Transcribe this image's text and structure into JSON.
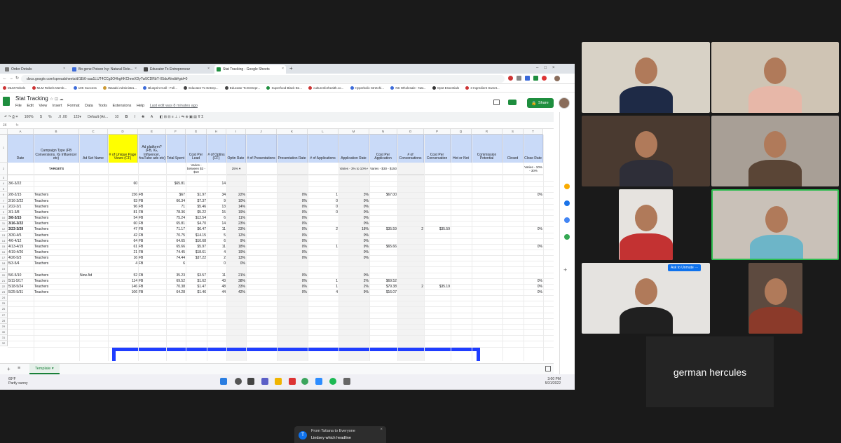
{
  "browser": {
    "tabs": [
      {
        "label": "Order Details",
        "color": "#777777"
      },
      {
        "label": "Bo gene Poison Ivy: Natural Rele...",
        "color": "#3b6ad9"
      },
      {
        "label": "Educator To Entrepreneur",
        "color": "#444444"
      },
      {
        "label": "Stat Tracking - Google Sheets",
        "color": "#1e8e3e"
      }
    ],
    "new_tab": "+",
    "url": "docs.google.com/spreadsheets/d/1Ei6-xaa1LUT4CCg3O4hgHKChnnXDyTw5CDRbT-X5dcA/edit#gid=0",
    "bookmarks": [
      "MLM Rebels",
      "MLM Rebels Memb...",
      "10K Success",
      "Wasabi Administra...",
      "Blueprint Call - Foll...",
      "Educator To Entrep...",
      "Educator To Entrepr...",
      "Superfood Black Be...",
      "culturesforhealth.co...",
      "Hyperbolic Stretchi...",
      "NS Wholesale - Nat...",
      "Opst Essentials",
      "3 Ingredient Sweet..."
    ]
  },
  "sheets": {
    "title": "Stat Tracking",
    "menus": [
      "File",
      "Edit",
      "View",
      "Insert",
      "Format",
      "Data",
      "Tools",
      "Extensions",
      "Help"
    ],
    "last_edit": "Last edit was 8 minutes ago",
    "share": "Share",
    "toolbar": {
      "zoom": "100%",
      "currency": "$",
      "percent": "%",
      "decimals": ".0  .00",
      "format": "123▾",
      "font": "Default (Ari...",
      "size": "10",
      "bold": "B",
      "italic": "I",
      "strike": "S",
      "color": "A"
    },
    "namebox": "J4",
    "columns": [
      "A",
      "B",
      "C",
      "D",
      "E",
      "F",
      "G",
      "H",
      "I",
      "J",
      "K",
      "L",
      "M",
      "N",
      "O",
      "P",
      "Q",
      "R",
      "S",
      "T"
    ],
    "headers": [
      "Date",
      "Campaign Type (FB Conversions, IG Influencer etc)",
      "Ad Set Name",
      "# of Unique Page Views (CF)",
      "Ad platform? (FB, IG, Influencer, YouTube ads etc)",
      "Total Spent",
      "Cost Per Lead",
      "# of Optins (CF)",
      "Optin Rate",
      "# of Presentations",
      "Presentation Rate",
      "# of Applications",
      "Application Rate",
      "Cost Per Application",
      "# of Conversations",
      "Cost Per Conversation",
      "Hot or Not",
      "Commission Potential",
      "Closed",
      "Close Rate"
    ],
    "targets": {
      "label": "TARGETS",
      "cost_per_lead": "Varies - between $3 - $10",
      "optin_rate": "25% ▾",
      "application_rate": "Varies - 3% to 10%+",
      "cost_per_application": "Varies - $30 - $150",
      "close_rate": "Varies - 10% - 30%"
    },
    "row_numbers": [
      "1",
      "2",
      "3",
      "4",
      "5",
      "6",
      "7",
      "8",
      "9",
      "10",
      "11",
      "12",
      "13",
      "14",
      "15",
      "16",
      "17",
      "18",
      "19",
      "20",
      "21",
      "22",
      "23",
      "24",
      "25",
      "26",
      "27",
      "28",
      "29",
      "30",
      "31",
      "32"
    ],
    "rows": [
      {
        "row": 3,
        "date": "3/6-3/22",
        "views": "60",
        "spent": "$65.81",
        "optins": "14"
      },
      {
        "row": 5,
        "date": "2/8-2/15",
        "campaign": "Teachers",
        "views": "156",
        "platform": "FB",
        "spent": "$67",
        "cpl": "$1.97",
        "optins": "34",
        "optin_rate": "22%",
        "pres_rate": "0%",
        "apps": "1",
        "app_rate": "3%",
        "cpa": "$67.00",
        "close_rate": "0%"
      },
      {
        "row": 6,
        "date": "2/16-2/22",
        "campaign": "Teachers",
        "views": "93",
        "platform": "FB",
        "spent": "66.34",
        "cpl": "$7.37",
        "optins": "9",
        "optin_rate": "10%",
        "pres_rate": "0%",
        "apps": "0",
        "app_rate": "0%"
      },
      {
        "row": 7,
        "date": "2/22-3/1",
        "campaign": "Teachers",
        "views": "96",
        "platform": "FB",
        "spent": "71",
        "cpl": "$5.46",
        "optins": "13",
        "optin_rate": "14%",
        "pres_rate": "0%",
        "apps": "0",
        "app_rate": "0%"
      },
      {
        "row": 8,
        "date": "3/1-3/8",
        "campaign": "Teachers",
        "views": "81",
        "platform": "FB",
        "spent": "78.36",
        "cpl": "$5.22",
        "optins": "15",
        "optin_rate": "19%",
        "pres_rate": "0%",
        "apps": "0",
        "app_rate": "0%"
      },
      {
        "row": 9,
        "date": "3/8-3/15",
        "campaign": "Teachers",
        "views": "54",
        "platform": "FB",
        "spent": "75.24",
        "cpl": "$12.54",
        "optins": "6",
        "optin_rate": "11%",
        "pres_rate": "0%",
        "app_rate": "0%"
      },
      {
        "row": 10,
        "date": "3/16-3/22",
        "campaign": "Teachers",
        "views": "60",
        "platform": "FB",
        "spent": "65.81",
        "cpl": "$4.70",
        "optins": "14",
        "optin_rate": "23%",
        "pres_rate": "0%",
        "app_rate": "0%"
      },
      {
        "row": 11,
        "date": "3/23-3/29",
        "campaign": "Teachers",
        "views": "47",
        "platform": "FB",
        "spent": "71.17",
        "cpl": "$6.47",
        "optins": "11",
        "optin_rate": "23%",
        "pres_rate": "0%",
        "apps": "2",
        "app_rate": "18%",
        "cpa": "$35.59",
        "convos": "2",
        "cpc": "$35.59",
        "close_rate": "0%"
      },
      {
        "row": 12,
        "date": "3/30-4/5",
        "campaign": "Teachers",
        "views": "42",
        "platform": "FB",
        "spent": "70.75",
        "cpl": "$14.15",
        "optins": "5",
        "optin_rate": "12%",
        "pres_rate": "0%",
        "app_rate": "0%"
      },
      {
        "row": 13,
        "date": "4/6-4/12",
        "campaign": "Teachers",
        "views": "64",
        "platform": "FB",
        "spent": "64.65",
        "cpl": "$10.68",
        "optins": "6",
        "optin_rate": "9%",
        "pres_rate": "0%",
        "app_rate": "0%"
      },
      {
        "row": 14,
        "date": "4/13-4/19",
        "campaign": "Teachers",
        "views": "61",
        "platform": "FB",
        "spent": "65.66",
        "cpl": "$5.97",
        "optins": "11",
        "optin_rate": "18%",
        "pres_rate": "0%",
        "apps": "1",
        "app_rate": "9%",
        "cpa": "$65.66",
        "close_rate": "0%"
      },
      {
        "row": 15,
        "date": "4/19-4/26",
        "campaign": "Teachers",
        "views": "21",
        "platform": "FB",
        "spent": "74.45",
        "cpl": "$18.61",
        "optins": "4",
        "optin_rate": "19%",
        "pres_rate": "0%",
        "app_rate": "0%"
      },
      {
        "row": 16,
        "date": "4/26-5/3",
        "campaign": "Teachers",
        "views": "16",
        "platform": "FB",
        "spent": "74.44",
        "cpl": "$37.22",
        "optins": "2",
        "optin_rate": "13%",
        "pres_rate": "0%",
        "app_rate": "0%"
      },
      {
        "row": 17,
        "date": "5/3-5/4",
        "campaign": "Teachers",
        "views": "4",
        "platform": "FB",
        "spent": "6",
        "optins": "0",
        "optin_rate": "0%"
      },
      {
        "row": 19,
        "date": "5/6-5/10",
        "campaign": "Teachers",
        "adset": "New Ad",
        "views": "52",
        "platform": "FB",
        "spent": "35.23",
        "cpl": "$3.57",
        "optins": "11",
        "optin_rate": "21%",
        "pres_rate": "0%",
        "app_rate": "0%"
      },
      {
        "row": 20,
        "date": "5/11-5/17",
        "campaign": "Teachers",
        "views": "114",
        "platform": "FB",
        "spent": "69.52",
        "cpl": "$1.62",
        "optins": "43",
        "optin_rate": "38%",
        "pres_rate": "0%",
        "apps": "1",
        "app_rate": "2%",
        "cpa": "$69.52",
        "close_rate": "0%"
      },
      {
        "row": 21,
        "date": "5/18-5/24",
        "campaign": "Teachers",
        "views": "146",
        "platform": "FB",
        "spent": "70.38",
        "cpl": "$1.47",
        "optins": "48",
        "optin_rate": "33%",
        "pres_rate": "0%",
        "apps": "1",
        "app_rate": "2%",
        "cpa": "$79.38",
        "convos": "2",
        "cpc": "$35.19",
        "close_rate": "0%"
      },
      {
        "row": 22,
        "date": "5/25-5/31",
        "campaign": "Teachers",
        "views": "106",
        "platform": "FB",
        "spent": "64.28",
        "cpl": "$1.46",
        "optins": "44",
        "optin_rate": "42%",
        "pres_rate": "0%",
        "apps": "4",
        "app_rate": "9%",
        "cpa": "$16.07",
        "close_rate": "0%"
      }
    ],
    "sheet_tab": "Template",
    "add_sheet": "+",
    "all_sheets": "≡"
  },
  "taskbar": {
    "temp": "69°F",
    "weather": "Partly sunny",
    "time": "3:00 PM",
    "date": "5/31/2022"
  },
  "zoom": {
    "participants": [
      {
        "role": "participant",
        "color_bg": "#d8d2c6",
        "color_person": "#1e2a46"
      },
      {
        "role": "participant",
        "color_bg": "#cfc4b4",
        "color_person": "#e7b7a8"
      },
      {
        "role": "participant",
        "color_bg": "#4a3a30",
        "color_person": "#2e2e38"
      },
      {
        "role": "participant",
        "color_bg": "#a89f96",
        "color_person": "#5a4536"
      },
      {
        "role": "participant",
        "color_bg": "#e6e3df",
        "color_person": "#c33232"
      },
      {
        "role": "active-speaker",
        "color_bg": "#c9c1b8",
        "color_person": "#6db5c8"
      },
      {
        "role": "participant",
        "color_bg": "#e5e3e0",
        "color_person": "#202020"
      },
      {
        "role": "participant",
        "color_bg": "#5d4a3f",
        "color_person": "#8b3a2a"
      }
    ],
    "ask_to_unmute": "Ask to Unmute",
    "more": "···",
    "name_tile": "german hercules",
    "chat": {
      "from": "From Tatiana to Everyone",
      "message": "Lindsey which headline",
      "avatar": "T",
      "close": "×"
    }
  },
  "colors": {
    "accent_green": "#1e8e3e",
    "header_blue": "#c9daf8",
    "highlight_yellow": "#ffff00",
    "annotation_blue": "#1f3dff",
    "zoom_blue": "#0e72ed"
  }
}
